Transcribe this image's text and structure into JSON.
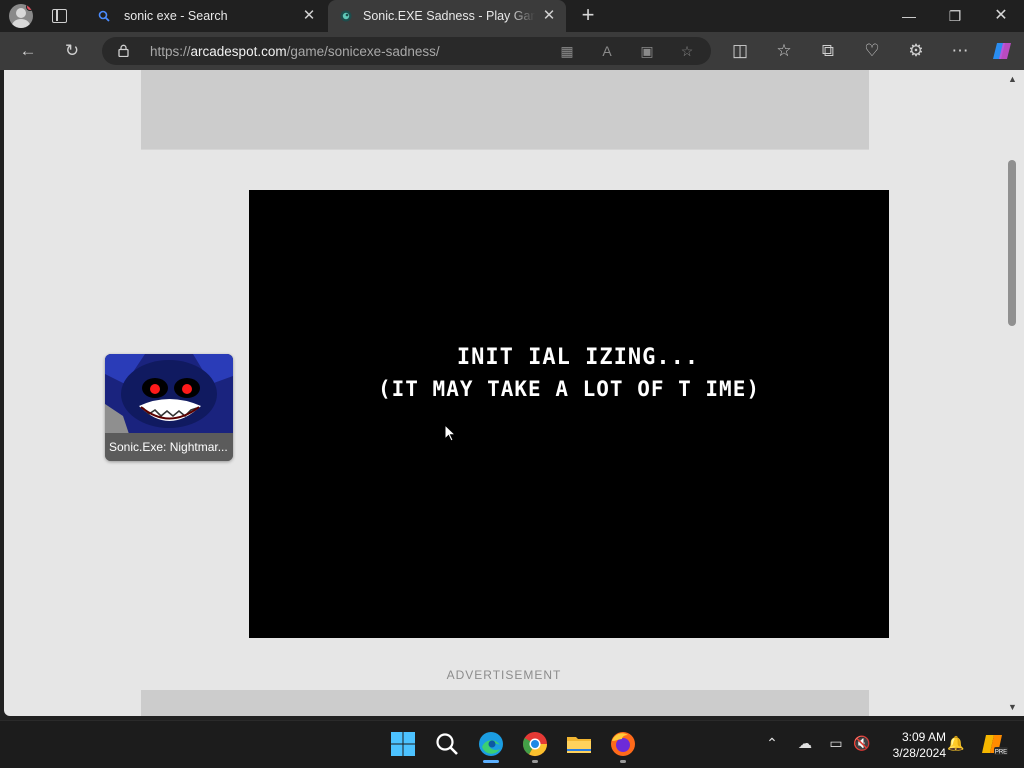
{
  "browser": {
    "tabs": [
      {
        "label": "sonic exe - Search",
        "active": false
      },
      {
        "label": "Sonic.EXE Sadness - Play Game O",
        "active": true
      }
    ],
    "address": {
      "prefix": "https://",
      "host": "arcadespot.com",
      "path": "/game/sonicexe-sadness/"
    }
  },
  "page": {
    "game_line1": "INIT IAL IZING...",
    "game_line2": "(IT MAY TAKE A LOT OF T IME)",
    "related_game_label": "Sonic.Exe: Nightmar...",
    "advertisement_label": "ADVERTISEMENT"
  },
  "taskbar": {
    "time": "3:09 AM",
    "date": "3/28/2024"
  },
  "colors": {
    "chrome_bg": "#202020",
    "toolbar_bg": "#3b3b3b",
    "page_bg": "#e6e6e6",
    "game_bg": "#000000",
    "edge_accent": "#5cb0ff"
  }
}
